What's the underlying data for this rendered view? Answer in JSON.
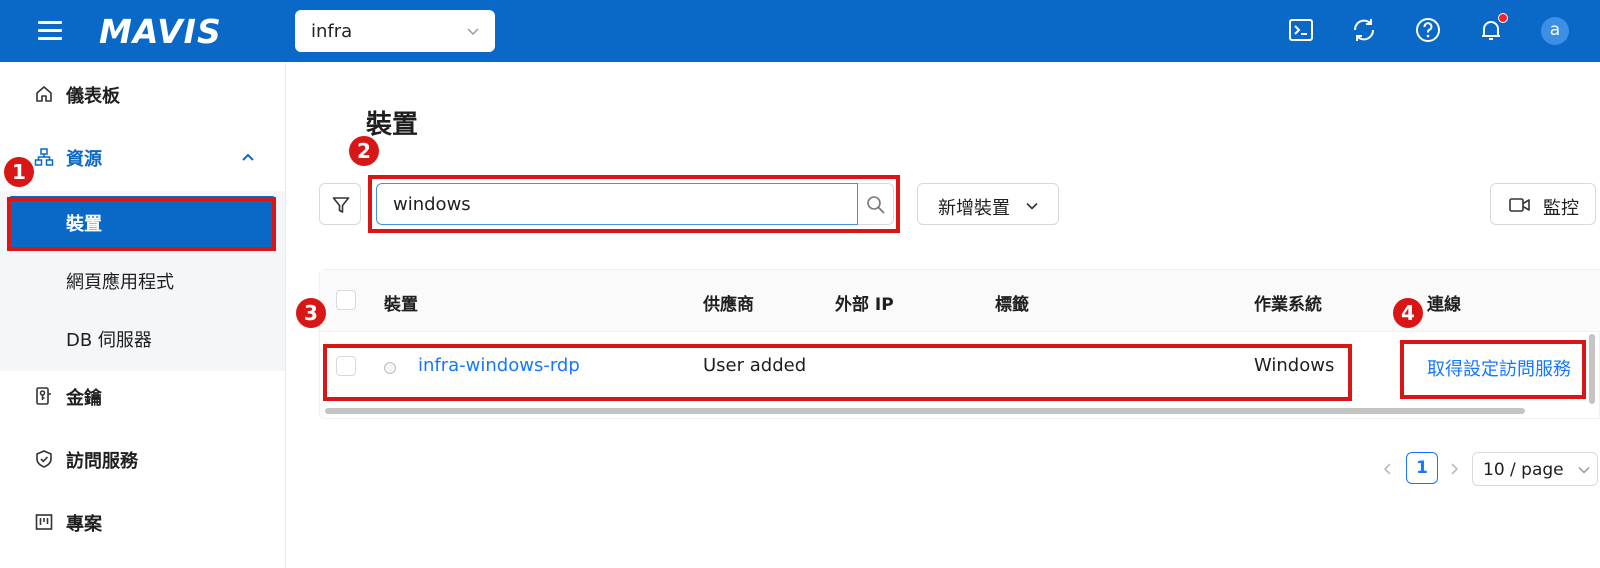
{
  "topbar": {
    "logo": "MAVIS",
    "project_select": {
      "value": "infra"
    },
    "icons": [
      "terminal-icon",
      "refresh-icon",
      "help-icon",
      "bell-icon"
    ],
    "avatar_letter": "a"
  },
  "sidebar": {
    "items": [
      {
        "label": "儀表板",
        "icon": "home-icon"
      },
      {
        "label": "資源",
        "icon": "sitemap-icon",
        "expanded": true
      },
      {
        "label": "金鑰",
        "icon": "key-icon"
      },
      {
        "label": "訪問服務",
        "icon": "shield-check-icon"
      },
      {
        "label": "專案",
        "icon": "board-icon"
      }
    ],
    "resource_sub": [
      {
        "label": "裝置",
        "selected": true
      },
      {
        "label": "網頁應用程式"
      },
      {
        "label": "DB 伺服器"
      }
    ]
  },
  "main": {
    "title": "裝置",
    "search": {
      "value": "windows"
    },
    "add_button": "新增裝置",
    "monitor_button": "監控",
    "table": {
      "columns": [
        "裝置",
        "供應商",
        "外部 IP",
        "標籤",
        "作業系統",
        "連線"
      ],
      "rows": [
        {
          "device": "infra-windows-rdp",
          "vendor": "User added",
          "external_ip": "",
          "tags": "",
          "os": "Windows",
          "connection": "取得設定訪問服務"
        }
      ]
    },
    "pagination": {
      "current": "1",
      "page_size": "10 / page"
    }
  },
  "annotations": [
    "1",
    "2",
    "3",
    "4"
  ],
  "colors": {
    "brand": "#0a69c7",
    "link": "#1677ff",
    "annotation": "#d91616"
  }
}
